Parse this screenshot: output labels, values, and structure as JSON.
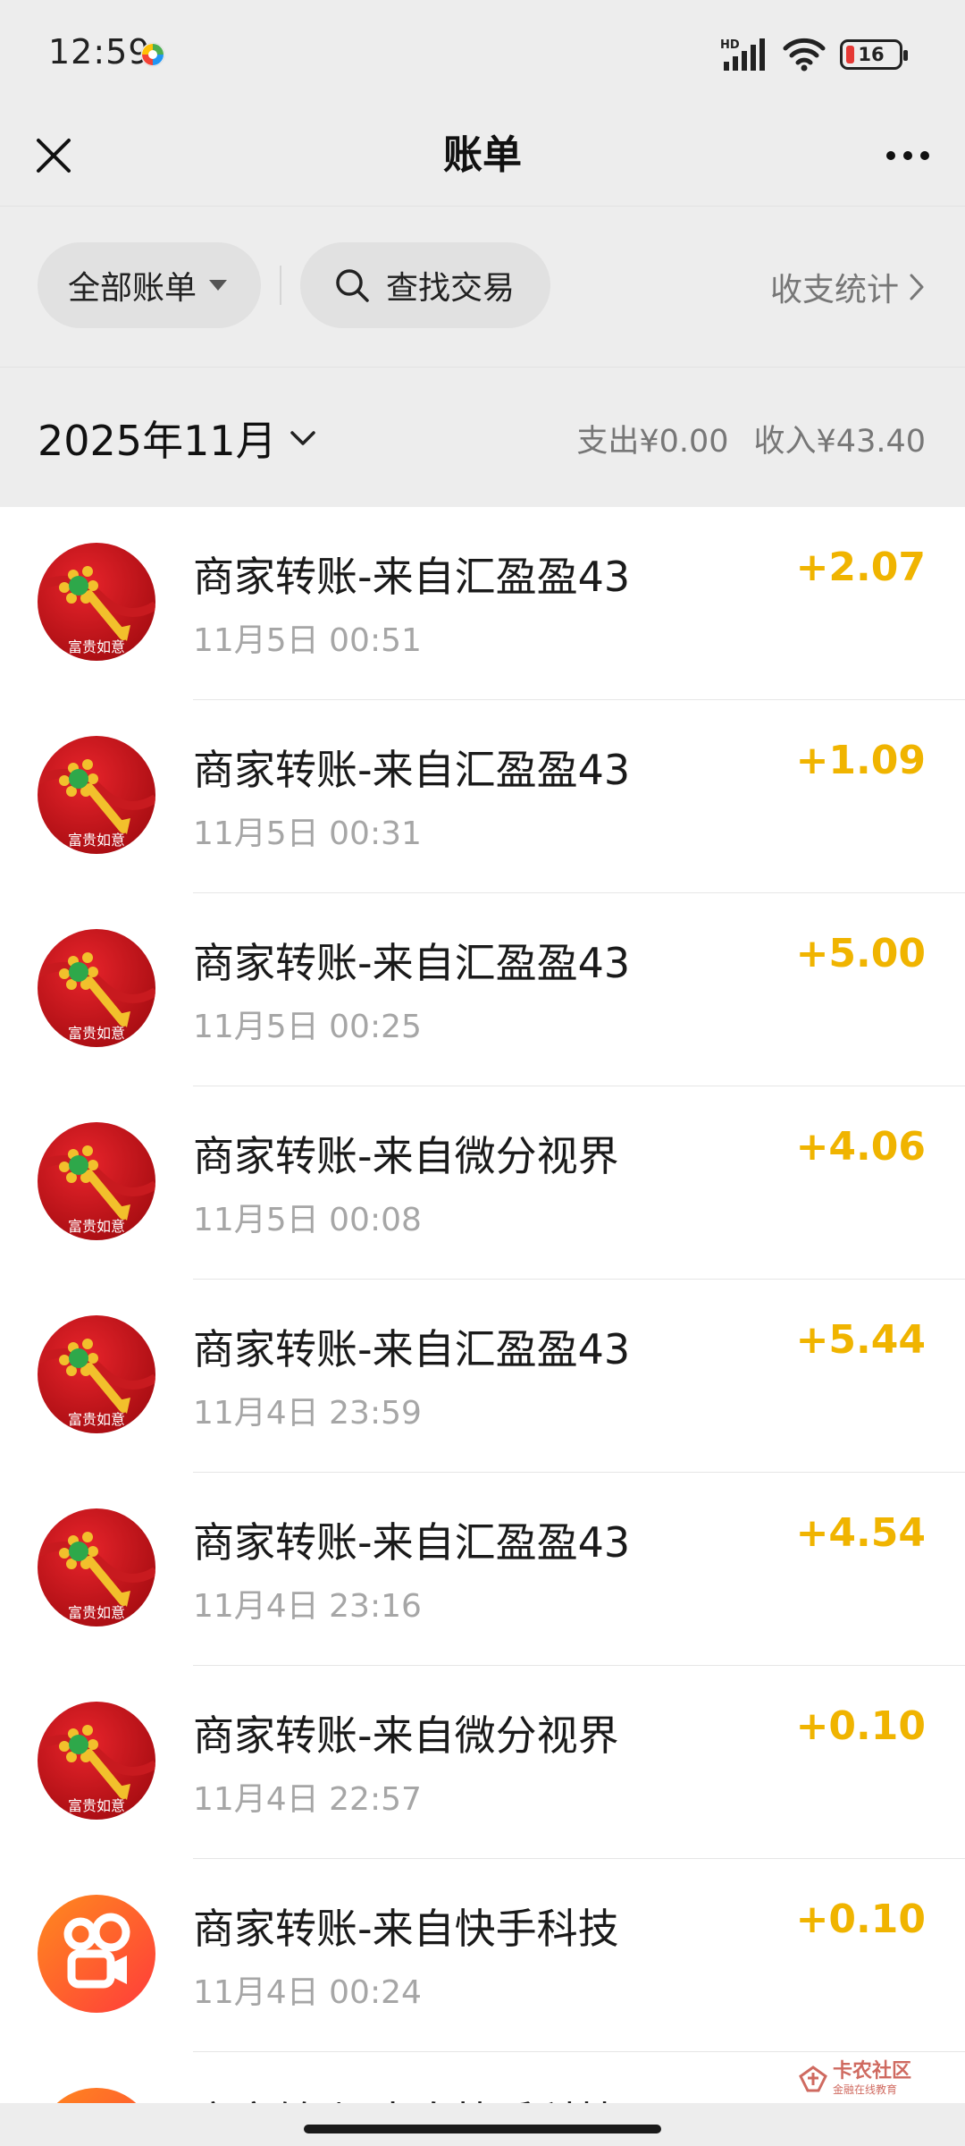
{
  "status_bar": {
    "time": "12:59",
    "network_label": "HD",
    "battery_level": "16"
  },
  "header": {
    "title": "账单",
    "close_icon": "close-icon",
    "more_icon": "more-dots-icon"
  },
  "filters": {
    "all_bills": "全部账单",
    "search": "查找交易",
    "stats": "收支统计"
  },
  "month": {
    "label": "2025年11月",
    "expense": "支出¥0.00",
    "income": "收入¥43.40"
  },
  "transactions": [
    {
      "title": "商家转账-来自汇盈盈43",
      "time": "11月5日 00:51",
      "amount": "+2.07",
      "icon": "ruyi-avatar"
    },
    {
      "title": "商家转账-来自汇盈盈43",
      "time": "11月5日 00:31",
      "amount": "+1.09",
      "icon": "ruyi-avatar"
    },
    {
      "title": "商家转账-来自汇盈盈43",
      "time": "11月5日 00:25",
      "amount": "+5.00",
      "icon": "ruyi-avatar"
    },
    {
      "title": "商家转账-来自微分视界",
      "time": "11月5日 00:08",
      "amount": "+4.06",
      "icon": "ruyi-avatar"
    },
    {
      "title": "商家转账-来自汇盈盈43",
      "time": "11月4日 23:59",
      "amount": "+5.44",
      "icon": "ruyi-avatar"
    },
    {
      "title": "商家转账-来自汇盈盈43",
      "time": "11月4日 23:16",
      "amount": "+4.54",
      "icon": "ruyi-avatar"
    },
    {
      "title": "商家转账-来自微分视界",
      "time": "11月4日 22:57",
      "amount": "+0.10",
      "icon": "ruyi-avatar"
    },
    {
      "title": "商家转账-来自快手科技",
      "time": "11月4日 00:24",
      "amount": "+0.10",
      "icon": "kuaishou-avatar"
    },
    {
      "title": "商家转账-来自快手科技",
      "time": "",
      "amount": "",
      "icon": "kuaishou-avatar"
    }
  ],
  "avatar_badge_text": "富贵如意",
  "watermark": {
    "main": "卡农社区",
    "sub": "金融在线教育"
  },
  "colors": {
    "amount": "#f0b400",
    "background": "#ededed",
    "list_bg": "#ffffff",
    "secondary_text": "#a6a6a6"
  }
}
